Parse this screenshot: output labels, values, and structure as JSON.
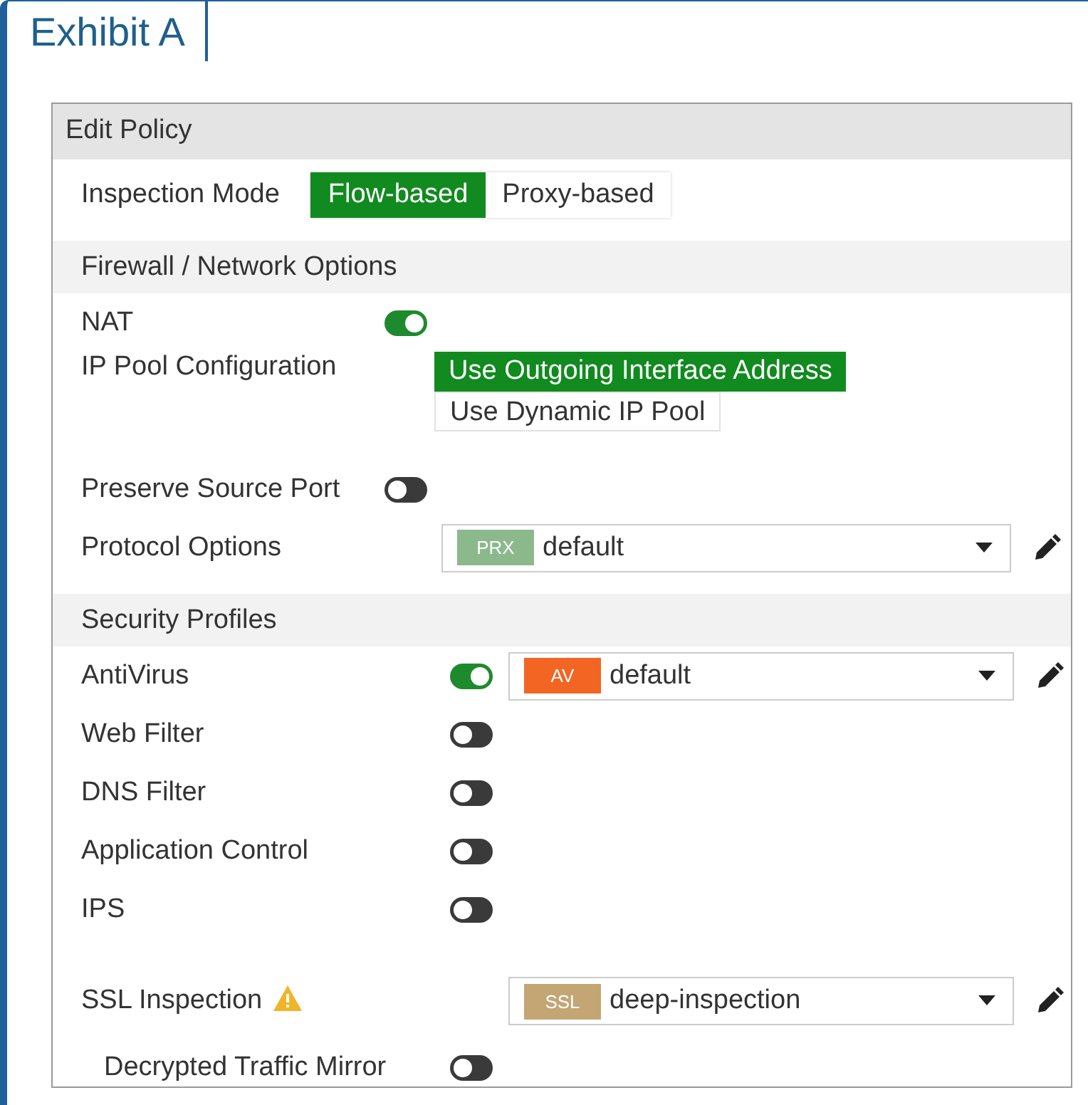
{
  "tab": {
    "label": "Exhibit A",
    "selected": true
  },
  "dialog": {
    "title": "Edit Policy",
    "inspection_mode": {
      "label": "Inspection Mode",
      "options": [
        {
          "label": "Flow-based",
          "selected": true
        },
        {
          "label": "Proxy-based",
          "selected": false
        }
      ]
    },
    "sections": [
      {
        "title": "Firewall / Network Options",
        "rows": [
          {
            "kind": "toggle",
            "label": "NAT",
            "on": true
          },
          {
            "kind": "choice",
            "label": "IP Pool Configuration",
            "options": [
              {
                "label": "Use Outgoing Interface Address",
                "selected": true
              },
              {
                "label": "Use Dynamic IP Pool",
                "selected": false
              }
            ]
          },
          {
            "kind": "toggle",
            "label": "Preserve Source Port",
            "on": false
          },
          {
            "kind": "select",
            "label": "Protocol Options",
            "badge": "PRX",
            "color": "#8cb98c",
            "value": "default"
          }
        ]
      },
      {
        "title": "Security Profiles",
        "rows": [
          {
            "kind": "toggle",
            "label": "AntiVirus",
            "on": true,
            "select": {
              "badge": "AV",
              "color": "#f26522",
              "value": "default"
            }
          },
          {
            "kind": "toggle",
            "label": "Web Filter",
            "on": false
          },
          {
            "kind": "toggle",
            "label": "DNS Filter",
            "on": false
          },
          {
            "kind": "toggle",
            "label": "Application Control",
            "on": false
          },
          {
            "kind": "toggle",
            "label": "IPS",
            "on": false
          },
          {
            "kind": "select",
            "label": "SSL Inspection",
            "warning": true,
            "badge": "SSL",
            "color": "#c4a574",
            "value": "deep-inspection",
            "children": [
              {
                "kind": "toggle",
                "label": "Decrypted Traffic Mirror",
                "on": false
              }
            ]
          }
        ]
      }
    ]
  }
}
